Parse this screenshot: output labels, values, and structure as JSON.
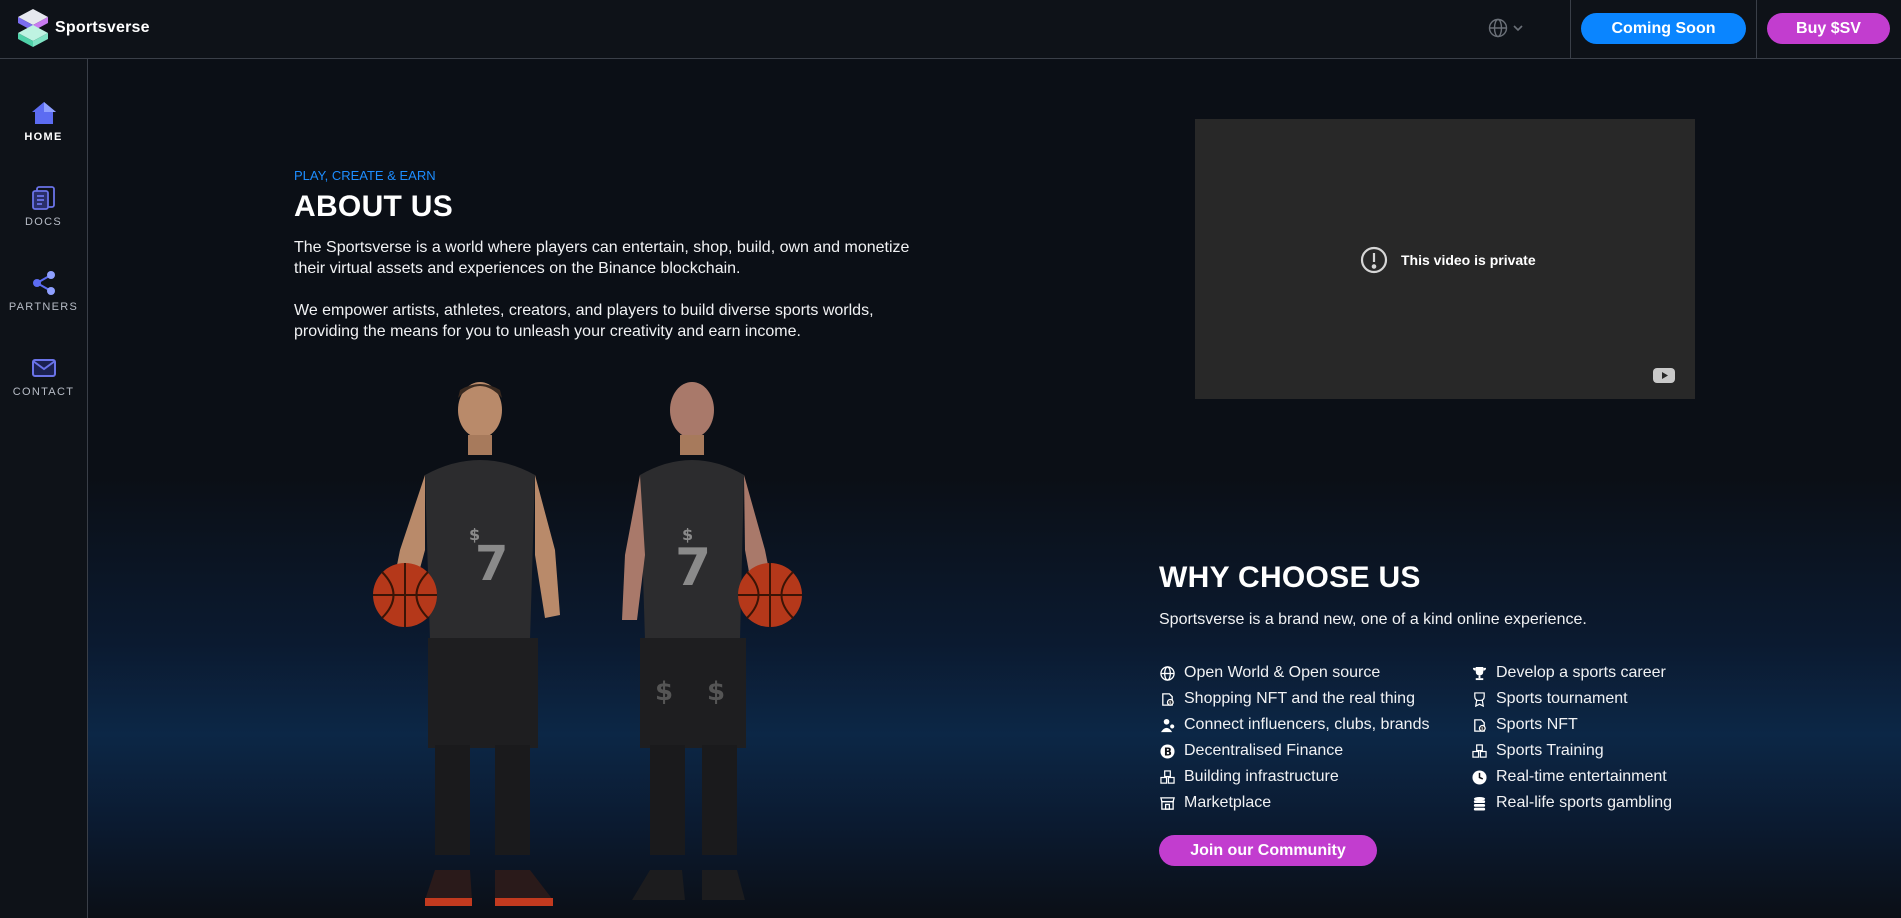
{
  "header": {
    "brand": "Sportsverse",
    "coming_soon": "Coming Soon",
    "buy": "Buy $SV"
  },
  "sidebar": {
    "items": [
      {
        "label": "HOME",
        "icon": "home-icon",
        "active": true
      },
      {
        "label": "DOCS",
        "icon": "docs-icon"
      },
      {
        "label": "PARTNERS",
        "icon": "share-icon"
      },
      {
        "label": "CONTACT",
        "icon": "mail-icon"
      }
    ]
  },
  "about": {
    "eyebrow": "PLAY, CREATE & EARN",
    "title": "ABOUT US",
    "p1": "The Sportsverse is a world where players can entertain, shop, build, own and monetize their virtual assets and experiences on the Binance blockchain.",
    "p2": "We empower artists, athletes, creators, and players to build diverse sports worlds, providing the means for you to unleash your creativity and earn income."
  },
  "video": {
    "message": "This video is private"
  },
  "why": {
    "title": "WHY CHOOSE US",
    "subtitle": "Sportsverse is a brand new, one of a kind online experience.",
    "left": [
      {
        "label": "Open World & Open source",
        "icon": "globe-icon"
      },
      {
        "label": "Shopping NFT and the real thing",
        "icon": "nft-icon"
      },
      {
        "label": "Connect influencers, clubs, brands",
        "icon": "people-icon"
      },
      {
        "label": "Decentralised Finance",
        "icon": "bitcoin-icon"
      },
      {
        "label": "Building infrastructure",
        "icon": "cubes-icon"
      },
      {
        "label": "Marketplace",
        "icon": "store-icon"
      }
    ],
    "right": [
      {
        "label": "Develop a sports career",
        "icon": "trophy-icon"
      },
      {
        "label": "Sports tournament",
        "icon": "award-icon"
      },
      {
        "label": "Sports NFT",
        "icon": "nft-icon"
      },
      {
        "label": "Sports Training",
        "icon": "cubes-icon"
      },
      {
        "label": "Real-time entertainment",
        "icon": "clock-icon"
      },
      {
        "label": "Real-life sports gambling",
        "icon": "coins-icon"
      }
    ],
    "join": "Join our Community"
  },
  "colors": {
    "accent_blue": "#0a85ff",
    "accent_magenta": "#c23dcf",
    "background": "#0b0f16"
  }
}
